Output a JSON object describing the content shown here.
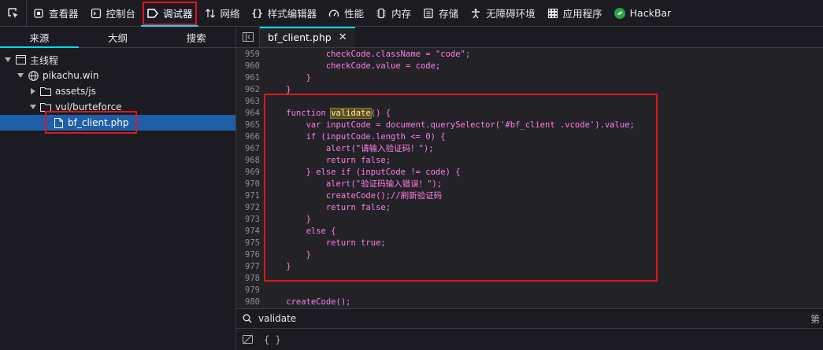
{
  "toolbar": {
    "tabs": [
      {
        "label": "查看器",
        "icon": "inspector-icon"
      },
      {
        "label": "控制台",
        "icon": "console-icon"
      },
      {
        "label": "调试器",
        "icon": "debugger-icon"
      },
      {
        "label": "网络",
        "icon": "network-icon"
      },
      {
        "label": "样式编辑器",
        "icon": "style-editor-icon"
      },
      {
        "label": "性能",
        "icon": "performance-icon"
      },
      {
        "label": "内存",
        "icon": "memory-icon"
      },
      {
        "label": "存储",
        "icon": "storage-icon"
      },
      {
        "label": "无障碍环境",
        "icon": "accessibility-icon"
      },
      {
        "label": "应用程序",
        "icon": "application-icon"
      },
      {
        "label": "HackBar",
        "icon": "hackbar-icon"
      }
    ],
    "active_tab": "调试器"
  },
  "left_pane": {
    "tabs": [
      "来源",
      "大纲",
      "搜索"
    ],
    "active_tab": "来源",
    "tree": [
      {
        "label": "主线程",
        "level": 0
      },
      {
        "label": "pikachu.win",
        "level": 1
      },
      {
        "label": "assets/js",
        "level": 2
      },
      {
        "label": "vul/burteforce",
        "level": 2
      },
      {
        "label": "bf_client.php",
        "level": 3,
        "selected": true
      }
    ]
  },
  "editor": {
    "open_file": "bf_client.php",
    "first_line": 959,
    "lines": [
      {
        "no": "959",
        "text": "            checkCode.className = \"code\";"
      },
      {
        "no": "960",
        "text": "            checkCode.value = code;"
      },
      {
        "no": "961",
        "text": "        }"
      },
      {
        "no": "962",
        "text": "    }"
      },
      {
        "no": "963",
        "text": ""
      },
      {
        "no": "964",
        "pre": "    function ",
        "hl": "validate",
        "post": "() {"
      },
      {
        "no": "965",
        "text": "        var inputCode = document.querySelector('#bf_client .vcode').value;"
      },
      {
        "no": "966",
        "text": "        if (inputCode.length <= 0) {"
      },
      {
        "no": "967",
        "text": "            alert(\"请输入验证码！\");"
      },
      {
        "no": "968",
        "text": "            return false;"
      },
      {
        "no": "969",
        "text": "        } else if (inputCode != code) {"
      },
      {
        "no": "970",
        "text": "            alert(\"验证码输入错误！\");"
      },
      {
        "no": "971",
        "text": "            createCode();//刷新验证码"
      },
      {
        "no": "972",
        "text": "            return false;"
      },
      {
        "no": "973",
        "text": "        }"
      },
      {
        "no": "974",
        "text": "        else {"
      },
      {
        "no": "975",
        "text": "            return true;"
      },
      {
        "no": "976",
        "text": "        }"
      },
      {
        "no": "977",
        "text": "    }"
      },
      {
        "no": "978",
        "text": ""
      },
      {
        "no": "979",
        "text": ""
      },
      {
        "no": "980",
        "text": "    createCode();"
      }
    ]
  },
  "search": {
    "value": "validate",
    "right_label": "第"
  },
  "statusbar": {
    "braces": "{ }"
  },
  "colors": {
    "accent": "#00ddff",
    "annotation": "#e0141e",
    "selection": "#1f5fa8",
    "code_text": "#ff7de9"
  }
}
